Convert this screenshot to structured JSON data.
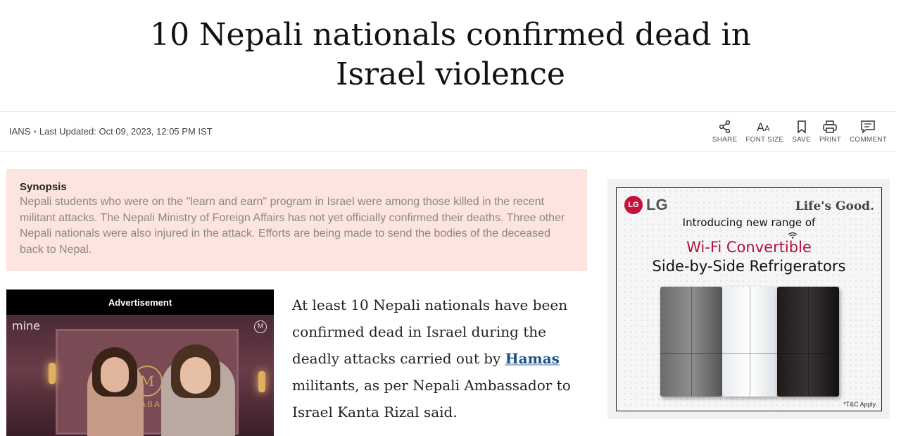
{
  "article": {
    "headline": "10 Nepali nationals confirmed dead in Israel violence",
    "source": "IANS",
    "last_updated": "Last Updated: Oct 09, 2023, 12:05 PM IST"
  },
  "actions": [
    {
      "label": "SHARE",
      "icon": "share-icon"
    },
    {
      "label": "FONT SIZE",
      "icon": "font-size-icon"
    },
    {
      "label": "SAVE",
      "icon": "bookmark-icon"
    },
    {
      "label": "PRINT",
      "icon": "print-icon"
    },
    {
      "label": "COMMENT",
      "icon": "comment-icon"
    }
  ],
  "synopsis": {
    "title": "Synopsis",
    "text": "Nepali students who were on the \"learn and earn\" program in Israel were among those killed in the recent militant attacks. The Nepali Ministry of Foreign Affairs has not yet officially confirmed their deaths. Three other Nepali nationals were also injured in the attack. Efforts are being made to send the bodies of the deceased back to Nepal."
  },
  "video_ad": {
    "label": "Advertisement",
    "brand_top_left": "mine",
    "brand_top_right": "M",
    "brand_center": "M",
    "brand_text": "ABAR"
  },
  "body": {
    "part1": "At least 10 Nepali nationals have been confirmed dead in Israel during the deadly attacks carried out by ",
    "link": "Hamas",
    "part2": " militants, as per Nepali Ambassador to Israel Kanta Rizal said."
  },
  "side_ad": {
    "logo_mark": "LG",
    "logo_text": "LG",
    "tagline": "Life's Good.",
    "intro": "Introducing new range of",
    "highlight": "Wi-Fi Convertible",
    "product": "Side-by-Side Refrigerators",
    "disclaimer": "*T&C Apply."
  },
  "colors": {
    "synopsis_bg": "#fde4df",
    "link": "#1c4f88",
    "lg_red": "#c4123a",
    "wifi_red": "#b3123d"
  }
}
